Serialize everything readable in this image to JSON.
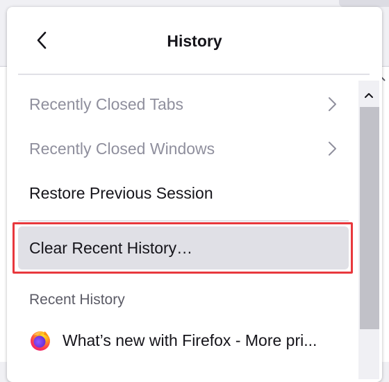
{
  "panel": {
    "title": "History",
    "back_icon": "chevron-left-icon"
  },
  "menu": {
    "recently_closed_tabs": "Recently Closed Tabs",
    "recently_closed_windows": "Recently Closed Windows",
    "restore_previous_session": "Restore Previous Session",
    "clear_recent_history": "Clear Recent History…",
    "chevron_icon": "chevron-right-icon"
  },
  "recent_history": {
    "section_label": "Recent History",
    "items": [
      {
        "title": "What’s new with Firefox - More pri...",
        "icon": "firefox-icon"
      }
    ]
  },
  "colors": {
    "highlight_outline": "#e8383d",
    "hover_background": "#e0e0e6",
    "disabled_text": "#8f8f9d",
    "text": "#15141a"
  }
}
